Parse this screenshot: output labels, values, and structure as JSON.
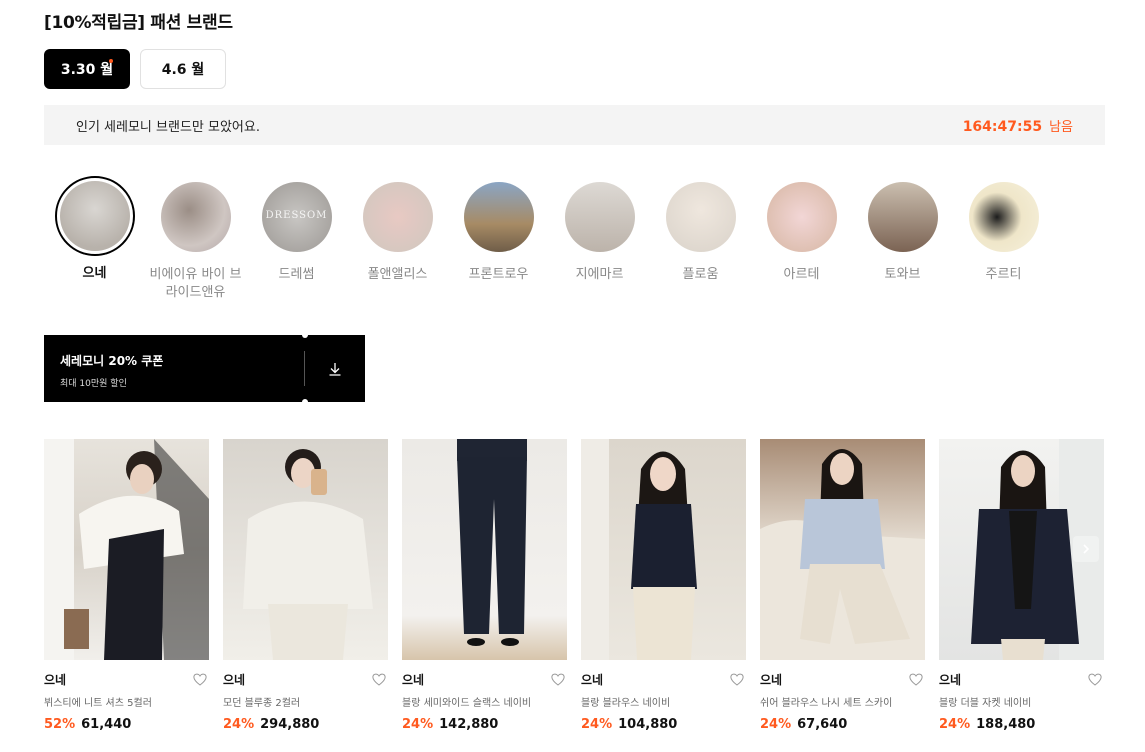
{
  "page": {
    "title": "[10%적립금] 패션 브랜드"
  },
  "date_tabs": [
    {
      "label": "3.30 월",
      "active": true,
      "has_dot": true
    },
    {
      "label": "4.6 월",
      "active": false,
      "has_dot": false
    }
  ],
  "info_bar": {
    "text": "인기 세레모니 브랜드만 모았어요.",
    "timer": "164:47:55",
    "timer_suffix": "남음"
  },
  "brands": [
    {
      "label": "으네",
      "active": true
    },
    {
      "label": "비에이유 바이 브라이드앤유",
      "active": false
    },
    {
      "label": "드레썸",
      "active": false,
      "watermark": "DRESSOM"
    },
    {
      "label": "폴앤앨리스",
      "active": false
    },
    {
      "label": "프론트로우",
      "active": false
    },
    {
      "label": "지에마르",
      "active": false
    },
    {
      "label": "플로움",
      "active": false
    },
    {
      "label": "아르테",
      "active": false
    },
    {
      "label": "토와브",
      "active": false
    },
    {
      "label": "주르티",
      "active": false
    }
  ],
  "coupon": {
    "title": "세레모니 20% 쿠폰",
    "subtitle": "최대 10만원 할인",
    "icon": "download-icon"
  },
  "products": [
    {
      "brand": "으네",
      "name": "뷔스티에 니트 셔츠 5컬러",
      "discount": "52%",
      "price": "61,440"
    },
    {
      "brand": "으네",
      "name": "모던 블루종 2컬러",
      "discount": "24%",
      "price": "294,880"
    },
    {
      "brand": "으네",
      "name": "블랑 세미와이드 슬랙스 네이비",
      "discount": "24%",
      "price": "142,880"
    },
    {
      "brand": "으네",
      "name": "블랑 블라우스 네이비",
      "discount": "24%",
      "price": "104,880"
    },
    {
      "brand": "으네",
      "name": "쉬어 블라우스 나시 세트 스카이",
      "discount": "24%",
      "price": "67,640"
    },
    {
      "brand": "으네",
      "name": "블랑 더블 자켓 네이비",
      "discount": "24%",
      "price": "188,480"
    }
  ],
  "colors": {
    "accent": "#ff5a1f",
    "active_tab": "#000000",
    "info_bg": "#f4f4f4"
  },
  "icons": {
    "wishlist": "heart-icon",
    "carousel_next": "chevron-right-icon"
  }
}
